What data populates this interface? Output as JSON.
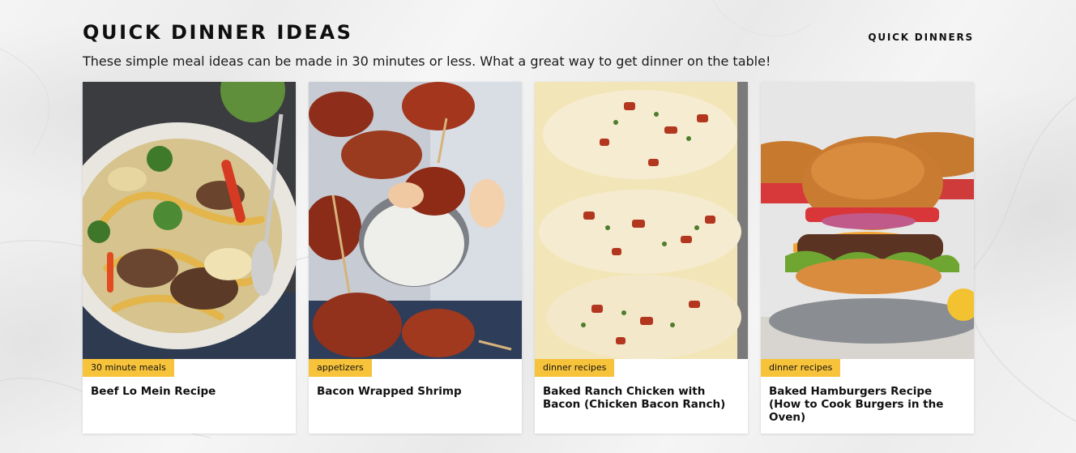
{
  "section": {
    "title": "QUICK DINNER IDEAS",
    "more_link": "QUICK DINNERS",
    "subtitle": "These simple meal ideas can be made in 30 minutes or less. What a great way to get dinner on the table!"
  },
  "cards": [
    {
      "tag": "30 minute meals",
      "title": "Beef Lo Mein Recipe",
      "image": "beef-lo-mein-photo"
    },
    {
      "tag": "appetizers",
      "title": "Bacon Wrapped Shrimp",
      "image": "bacon-wrapped-shrimp-photo"
    },
    {
      "tag": "dinner recipes",
      "title": "Baked Ranch Chicken with Bacon (Chicken Bacon Ranch)",
      "image": "baked-ranch-chicken-photo"
    },
    {
      "tag": "dinner recipes",
      "title": "Baked Hamburgers Recipe (How to Cook Burgers in the Oven)",
      "image": "baked-hamburgers-photo"
    }
  ],
  "colors": {
    "tag_background": "#f7c33a",
    "card_background": "#ffffff",
    "text": "#111111"
  }
}
